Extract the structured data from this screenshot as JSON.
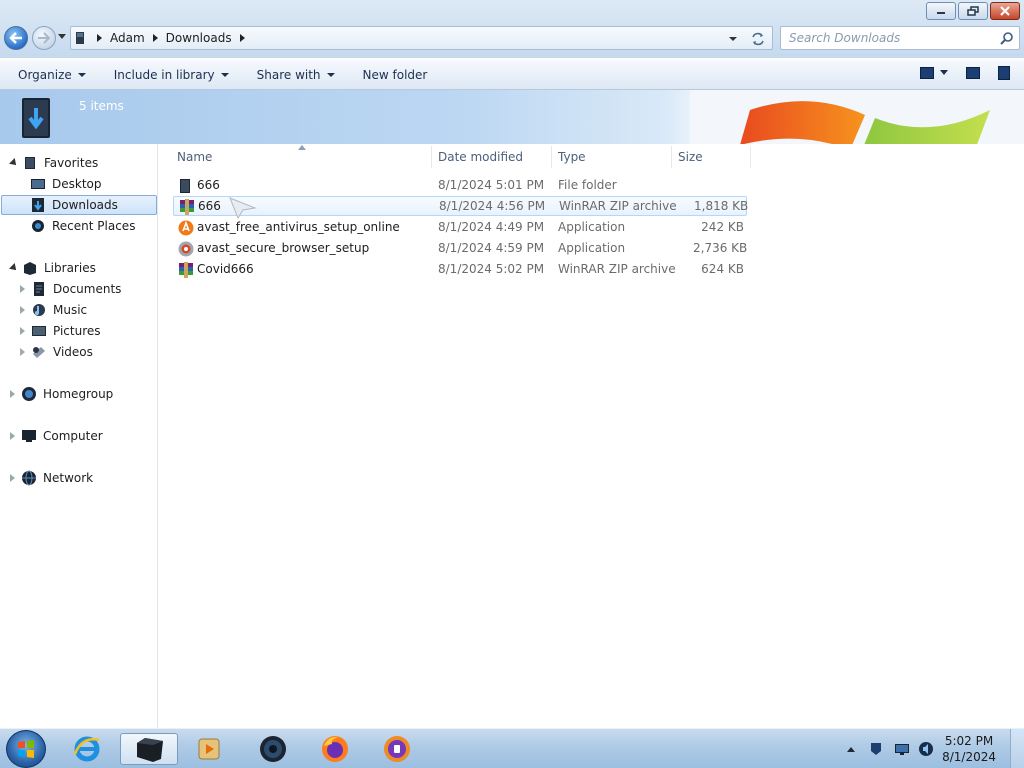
{
  "window": {
    "minimize_label": "",
    "restore_label": "",
    "close_label": ""
  },
  "address": {
    "crumbs": [
      "Adam",
      "Downloads"
    ]
  },
  "search": {
    "placeholder": "Search Downloads"
  },
  "toolbar": {
    "organize": "Organize",
    "include_in_library": "Include in library",
    "share_with": "Share with",
    "new_folder": "New folder"
  },
  "details": {
    "item_count": "5 items"
  },
  "nav": {
    "favorites": "Favorites",
    "desktop": "Desktop",
    "downloads": "Downloads",
    "recent_places": "Recent Places",
    "libraries": "Libraries",
    "documents": "Documents",
    "music": "Music",
    "pictures": "Pictures",
    "videos": "Videos",
    "homegroup": "Homegroup",
    "computer": "Computer",
    "network": "Network"
  },
  "columns": {
    "name": "Name",
    "date_modified": "Date modified",
    "type": "Type",
    "size": "Size"
  },
  "files": [
    {
      "name": "666",
      "date": "8/1/2024 5:01 PM",
      "type": "File folder",
      "size": "",
      "icon": "folder-icon"
    },
    {
      "name": "666",
      "date": "8/1/2024 4:56 PM",
      "type": "WinRAR ZIP archive",
      "size": "1,818 KB",
      "icon": "winrar-icon"
    },
    {
      "name": "avast_free_antivirus_setup_online",
      "date": "8/1/2024 4:49 PM",
      "type": "Application",
      "size": "242 KB",
      "icon": "avast-icon"
    },
    {
      "name": "avast_secure_browser_setup",
      "date": "8/1/2024 4:59 PM",
      "type": "Application",
      "size": "2,736 KB",
      "icon": "avast-browser-icon"
    },
    {
      "name": "Covid666",
      "date": "8/1/2024 5:02 PM",
      "type": "WinRAR ZIP archive",
      "size": "624 KB",
      "icon": "winrar-icon"
    }
  ],
  "taskbar": {
    "time": "5:02 PM",
    "date": "8/1/2024",
    "pinned": [
      "internet-explorer-icon",
      "explorer-icon",
      "media-player-icon",
      "unknown-app-icon",
      "firefox-icon",
      "avast-browser-icon"
    ]
  },
  "colors": {
    "accent": "#3c7fb1",
    "selection": "#cde3fa",
    "taskbar": "#aecae6"
  }
}
